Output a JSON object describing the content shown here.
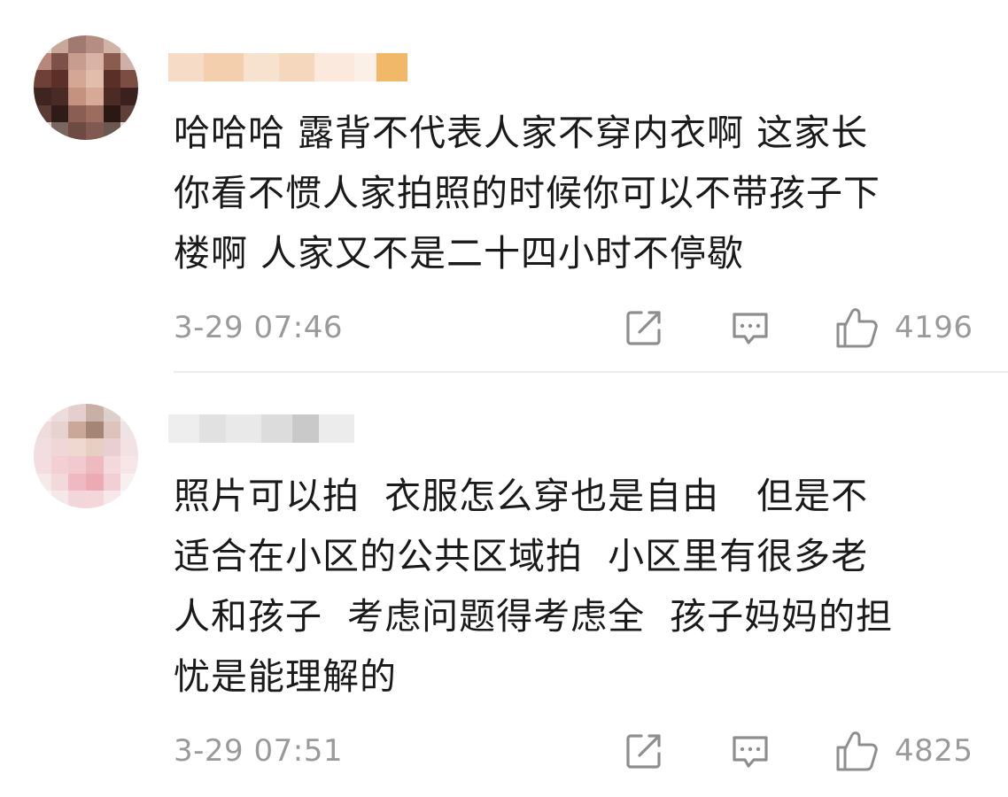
{
  "comments": [
    {
      "text": "哈哈哈 露背不代表人家不穿内衣啊 这家长\n你看不惯人家拍照的时候你可以不带孩子下\n楼啊 人家又不是二十四小时不停歇",
      "timestamp": "3-29 07:46",
      "likes": "4196",
      "icons": [
        "share-icon",
        "reply-icon",
        "like-icon"
      ]
    },
    {
      "text": "照片可以拍  衣服怎么穿也是自由   但是不\n适合在小区的公共区域拍  小区里有很多老\n人和孩子  考虑问题得考虑全  孩子妈妈的担\n忧是能理解的",
      "timestamp": "3-29 07:51",
      "likes": "4825",
      "icons": [
        "share-icon",
        "reply-icon",
        "like-icon"
      ]
    }
  ],
  "colors": {
    "text": "#1a1a1a",
    "meta": "#9a9a9a",
    "icon": "#8e8e8e",
    "divider": "#ececec"
  }
}
